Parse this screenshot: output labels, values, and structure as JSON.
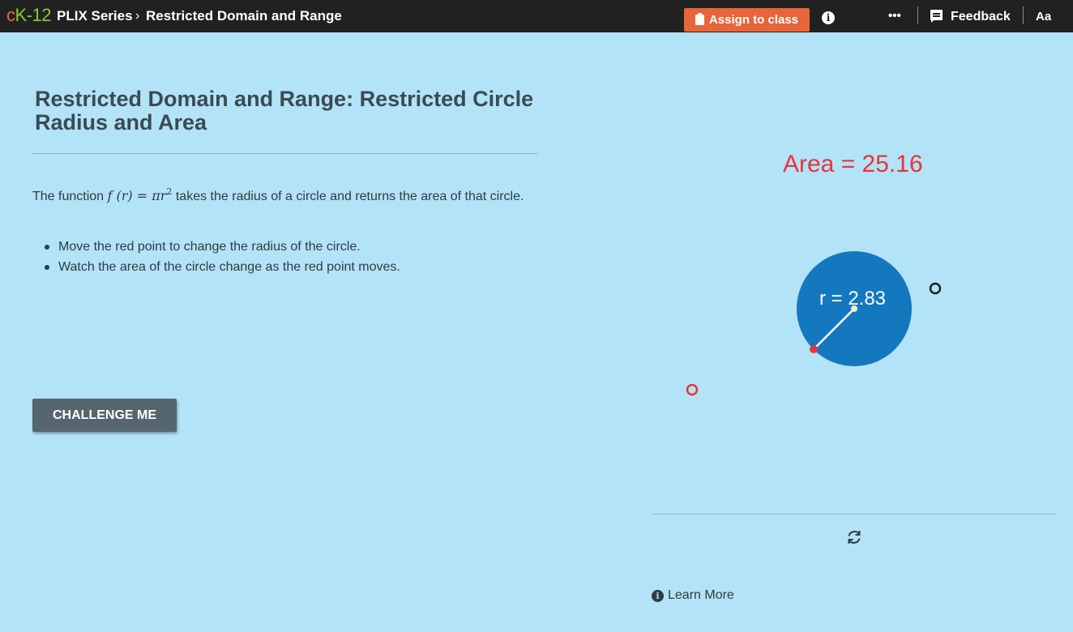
{
  "header": {
    "logo": {
      "c": "c",
      "k": "K",
      "rest": "-12"
    },
    "series": "PLIX Series",
    "separator": "›",
    "title": "Restricted Domain and Range",
    "assign_label": "Assign to class",
    "info_icon": "info-icon",
    "more_icon": "•••",
    "feedback_label": "Feedback",
    "font_size_label": "Aa"
  },
  "content": {
    "title": "Restricted Domain and Range: Restricted Circle Radius and Area",
    "intro_before": "The function",
    "intro_math": "f (r) = πr",
    "intro_math_exp": "2",
    "intro_after": "takes the radius of a circle and returns the area of that circle.",
    "bullets": [
      "Move the red point to change the radius of the circle.",
      "Watch the area of the circle change as the red point moves."
    ],
    "challenge_label": "CHALLENGE ME"
  },
  "interactive": {
    "area_text": "Area = 25.16",
    "radius_text": "r = 2.83",
    "radius_value": 2.83,
    "area_value": 25.16,
    "colors": {
      "circle": "#1478be",
      "point": "#e8343a",
      "area_text": "#e8343a",
      "hollow_red": "#e8343a",
      "hollow_dark": "#212121"
    },
    "learn_more_label": "Learn More",
    "reset_icon": "refresh-icon"
  }
}
